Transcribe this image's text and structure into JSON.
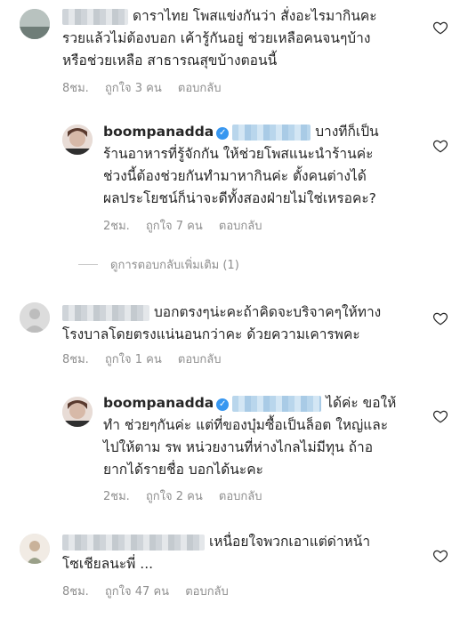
{
  "comments": [
    {
      "lines": [
        "ดาราไทย โพสแข่งกันว่า สั่งอะไรมากินคะ",
        "รวยแล้วไม่ต้องบอก เค้ารู้กันอยู่ ช่วยเหลือคนจนๆบ้าง",
        "หรือช่วยเหลือ สาธารณสุขบ้างตอนนี้"
      ],
      "time": "8ชม.",
      "likes": "ถูกใจ 3 คน",
      "reply": "ตอบกลับ"
    },
    {
      "username": "boompanadda",
      "lines": [
        "บางทีก็เป็น",
        "ร้านอาหารที่รู้จักกัน ให้ช่วยโพสแนะนำร้านค่ะ",
        "ช่วงนี้ต้องช่วยกันทำมาหากินค่ะ ตั้งคนต่างได้",
        "ผลประโยชน์ก็น่าจะดีทั้งสองฝ่ายไม่ใช่เหรอคะ?"
      ],
      "time": "2ชม.",
      "likes": "ถูกใจ 7 คน",
      "reply": "ตอบกลับ"
    },
    {
      "lines": [
        "บอกตรงๆน่ะคะถ้าคิดจะบริจาคๆให้ทาง",
        "โรงบาลโดยตรงแน่นอนกว่าคะ ด้วยความเคารพคะ"
      ],
      "time": "8ชม.",
      "likes": "ถูกใจ 1 คน",
      "reply": "ตอบกลับ"
    },
    {
      "username": "boompanadda",
      "lines": [
        "ได้ค่ะ ขอให้",
        "ทำ ช่วยๆกันค่ะ แต่ที่ของบุ๋มซื้อเป็นล็อต ใหญ่และ",
        "ไปให้ตาม รพ หน่วยงานที่ห่างไกลไม่มีทุน ถ้าอ",
        "ยากได้รายชื่อ บอกได้นะคะ"
      ],
      "time": "2ชม.",
      "likes": "ถูกใจ 2 คน",
      "reply": "ตอบกลับ"
    },
    {
      "lines": [
        "เหนื่อยใจพวกเอาแต่ด่าหน้า",
        "โซเชียลนะพี่ ..."
      ],
      "time": "8ชม.",
      "likes": "ถูกใจ 47 คน",
      "reply": "ตอบกลับ"
    }
  ],
  "view_more_replies": "ดูการตอบกลับเพิ่มเติม (1)",
  "icons": {
    "like": "heart-outline-icon",
    "verified": "verified-badge-icon"
  },
  "colors": {
    "verified": "#3897f0",
    "meta": "#8e8e8e",
    "text": "#262626"
  }
}
